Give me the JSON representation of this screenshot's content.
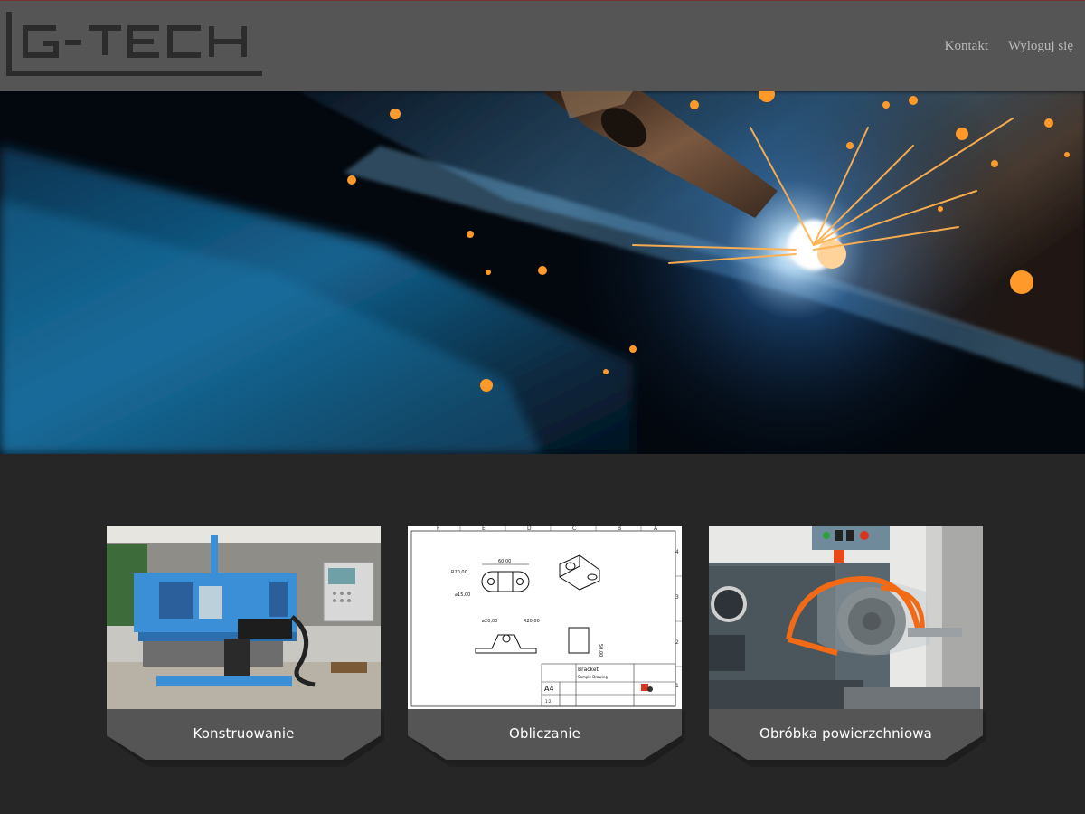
{
  "brand": {
    "logo_text": "G-TECH",
    "accent_color": "#555555",
    "logo_color": "#2c2c2c"
  },
  "nav": {
    "items": [
      {
        "label": "Kontakt"
      },
      {
        "label": "Wyloguj się"
      }
    ]
  },
  "hero": {
    "image": "welding-sparks-photo"
  },
  "services": [
    {
      "label": "Konstruowanie",
      "image": "milling-machine-photo"
    },
    {
      "label": "Obliczanie",
      "image": "technical-drawing-photo"
    },
    {
      "label": "Obróbka powierzchniowa",
      "image": "lathe-chuck-photo"
    }
  ],
  "drawing": {
    "dims": [
      "60,00",
      "R20,00",
      "⌀15,00",
      "⌀20,00",
      "R20,00",
      "50,00"
    ],
    "title_block": {
      "part": "Bracket",
      "subtitle": "Sample Drawing",
      "size": "A4",
      "scale": "1:2"
    }
  }
}
